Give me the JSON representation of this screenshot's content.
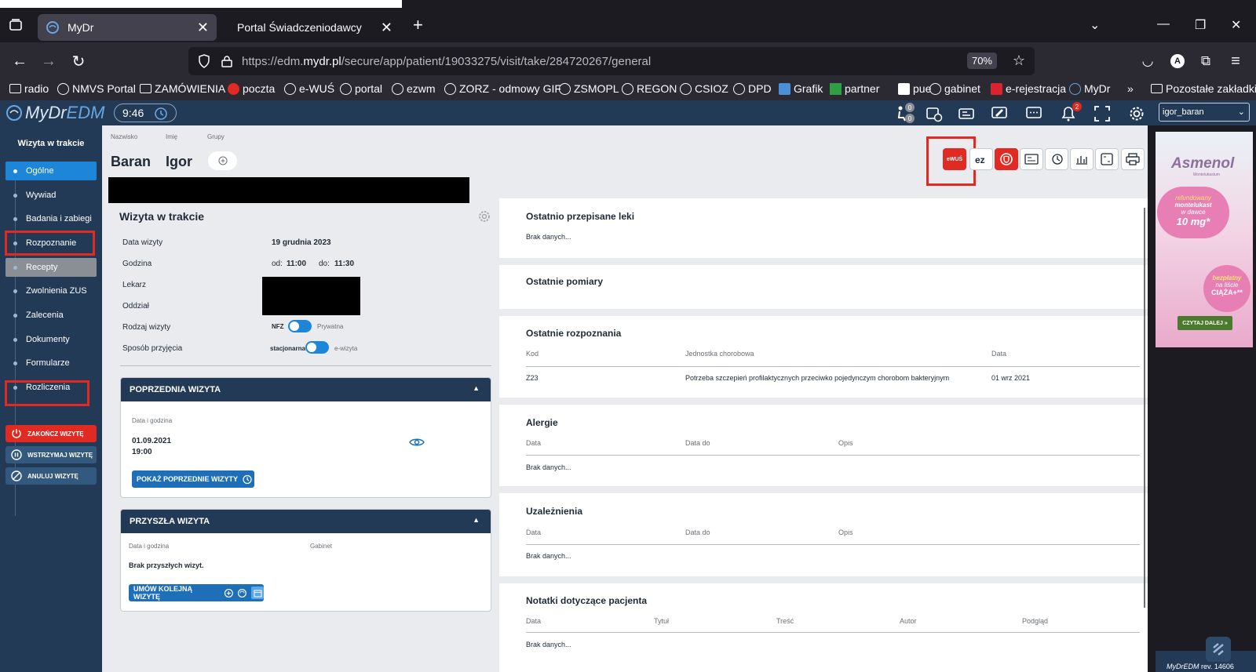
{
  "browser": {
    "tabs": [
      {
        "label": "MyDr",
        "active": true
      },
      {
        "label": "Portal Świadczeniodawcy",
        "active": false
      }
    ],
    "url_prefix": "https://edm.",
    "url_domain": "mydr.pl",
    "url_path": "/secure/app/patient/19033275/visit/take/284720267/general",
    "zoom": "70%",
    "profile_initial": "A",
    "bookmarks": [
      "radio",
      "NMVS Portal",
      "ZAMÓWIENIA",
      "poczta",
      "e-WUŚ",
      "portal",
      "ezwm",
      "ZORZ - odmowy GIF",
      "ZSMOPL",
      "REGON",
      "CSIOZ",
      "DPD",
      "Grafik",
      "partner",
      "pue",
      "gabinet",
      "e-rejestracja",
      "MyDr"
    ],
    "bookmarks_other": "Pozostałe zakładki"
  },
  "app": {
    "logo_mydr": "MyDr",
    "logo_edm": "EDM",
    "time": "9:46",
    "badges": {
      "patients_top": "0",
      "patients_bottom": "0",
      "notifications": "2"
    },
    "user": "igor_baran",
    "colors": {
      "navy": "#233a57",
      "accent_blue": "#1e86d8",
      "danger_red": "#e02a22"
    }
  },
  "sidebar": {
    "title": "Wizyta w trakcie",
    "items": [
      {
        "label": "Ogólne",
        "state": "active"
      },
      {
        "label": "Wywiad"
      },
      {
        "label": "Badania i zabiegi"
      },
      {
        "label": "Rozpoznanie"
      },
      {
        "label": "Recepty",
        "state": "gray"
      },
      {
        "label": "Zwolnienia ZUS"
      },
      {
        "label": "Zalecenia"
      },
      {
        "label": "Dokumenty"
      },
      {
        "label": "Formularze"
      },
      {
        "label": "Rozliczenia"
      }
    ],
    "btn_end": "ZAKOŃCZ WIZYTĘ",
    "btn_pause": "WSTRZYMAJ WIZYTĘ",
    "btn_cancel": "ANULUJ WIZYTĘ"
  },
  "patient": {
    "lbl_surname": "Nazwisko",
    "lbl_name": "Imię",
    "lbl_groups": "Grupy",
    "surname": "Baran",
    "name": "Igor",
    "ewus_label": "eWUŚ"
  },
  "visit": {
    "title": "Wizyta w trakcie",
    "lbl_date": "Data wizyty",
    "date": "19 grudnia 2023",
    "lbl_time": "Godzina",
    "from_lbl": "od:",
    "from": "11:00",
    "to_lbl": "do:",
    "to": "11:30",
    "lbl_doctor": "Lekarz",
    "lbl_department": "Oddział",
    "lbl_type": "Rodzaj wizyty",
    "type_left": "NFZ",
    "type_right": "Prywatna",
    "lbl_mode": "Sposób przyjęcia",
    "mode_left": "stacjonarna",
    "mode_right": "e-wizyta"
  },
  "previous_visit": {
    "title": "POPRZEDNIA WIZYTA",
    "lbl_datetime": "Data i godzina",
    "date": "01.09.2021",
    "time": "19:00",
    "btn": "POKAŻ POPRZEDNIE WIZYTY"
  },
  "next_visit": {
    "title": "PRZYSZŁA WIZYTA",
    "lbl_datetime": "Data i godzina",
    "lbl_room": "Gabinet",
    "empty": "Brak przyszłych wizyt.",
    "btn": "UMÓW KOLEJNĄ WIZYTĘ"
  },
  "right": {
    "meds": {
      "title": "Ostatnio przepisane leki",
      "empty": "Brak danych..."
    },
    "measures": {
      "title": "Ostatnie pomiary"
    },
    "diagnoses": {
      "title": "Ostatnie rozpoznania",
      "headers": [
        "Kod",
        "Jednostka chorobowa",
        "Data"
      ],
      "rows": [
        [
          "Z23",
          "Potrzeba szczepień profilaktycznych przeciwko pojedynczym chorobom bakteryjnym",
          "01 wrz 2021"
        ]
      ]
    },
    "allergies": {
      "title": "Alergie",
      "headers": [
        "Data",
        "Data do",
        "Opis"
      ],
      "empty": "Brak danych..."
    },
    "addictions": {
      "title": "Uzależnienia",
      "headers": [
        "Data",
        "Data do",
        "Opis"
      ],
      "empty": "Brak danych..."
    },
    "notes": {
      "title": "Notatki dotyczące pacjenta",
      "headers": [
        "Data",
        "Tytuł",
        "Treść",
        "Autor",
        "Podgląd"
      ],
      "empty": "Brak danych..."
    }
  },
  "ad": {
    "brand": "Asmenol",
    "sub": "Montelukastum",
    "bubble1_l1": "refundowany",
    "bubble1_l2": "montelukast",
    "bubble1_l3": "w dawce",
    "bubble1_l4": "10 mg*",
    "bubble2_l1": "bezpłatny",
    "bubble2_l2": "na liście",
    "bubble2_l3": "CIĄŻA+**",
    "cta": "CZYTAJ DALEJ »"
  },
  "footer": {
    "logo": "MyDrEDM",
    "rev": "rev. 14606"
  }
}
